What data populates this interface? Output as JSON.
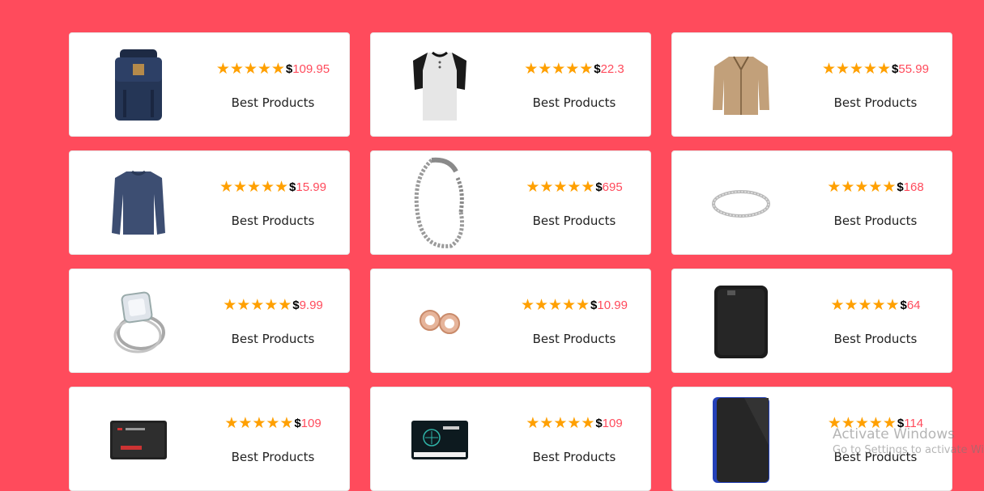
{
  "products": [
    {
      "image": "backpack",
      "price": "109.95",
      "label": "Best Products"
    },
    {
      "image": "henley-shirt",
      "price": "22.3",
      "label": "Best Products"
    },
    {
      "image": "jacket",
      "price": "55.99",
      "label": "Best Products"
    },
    {
      "image": "long-sleeve-shirt",
      "price": "15.99",
      "label": "Best Products"
    },
    {
      "image": "dragon-bracelet",
      "price": "695",
      "label": "Best Products"
    },
    {
      "image": "silver-ring",
      "price": "168",
      "label": "Best Products"
    },
    {
      "image": "diamond-ring",
      "price": "9.99",
      "label": "Best Products"
    },
    {
      "image": "ear-gauges",
      "price": "10.99",
      "label": "Best Products"
    },
    {
      "image": "external-hard-drive",
      "price": "64",
      "label": "Best Products"
    },
    {
      "image": "sandisk-ssd",
      "price": "109",
      "label": "Best Products"
    },
    {
      "image": "silicon-power-ssd",
      "price": "109",
      "label": "Best Products"
    },
    {
      "image": "wd-portable-drive",
      "price": "114",
      "label": "Best Products"
    }
  ],
  "currency_symbol": "$",
  "rating_stars": 5,
  "colors": {
    "background": "#ff4b5c",
    "star": "#ffa000",
    "price": "#ff4b5c",
    "card": "#ffffff"
  },
  "watermark": {
    "title": "Activate Windows",
    "subtitle": "Go to Settings to activate Windows."
  }
}
